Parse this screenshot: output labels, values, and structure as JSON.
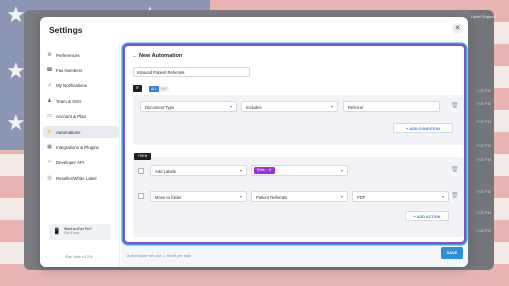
{
  "modal": {
    "title": "Settings",
    "close_icon": "close-icon"
  },
  "sidebar": {
    "items": [
      {
        "label": "Preferences",
        "icon": "gear-icon",
        "glyph": "⚙"
      },
      {
        "label": "Fax Numbers",
        "icon": "fax-icon",
        "glyph": "☎"
      },
      {
        "label": "My Notifications",
        "icon": "bell-icon",
        "glyph": "♫"
      },
      {
        "label": "Team & SSO",
        "icon": "team-icon",
        "glyph": "♟"
      },
      {
        "label": "Account & Plan",
        "icon": "card-icon",
        "glyph": "▭"
      },
      {
        "label": "Automations",
        "icon": "automation-icon",
        "glyph": "⚡"
      },
      {
        "label": "Integrations & Plugins",
        "icon": "plug-icon",
        "glyph": "▦"
      },
      {
        "label": "Developer API",
        "icon": "code-icon",
        "glyph": "‹›"
      },
      {
        "label": "Reseller/White Label",
        "icon": "globe-icon",
        "glyph": "◎"
      }
    ],
    "active_index": 5,
    "promo_title": "Want an iFax Pro?",
    "promo_sub": "Get it now",
    "version": "iFax Web v3.2.8"
  },
  "automation": {
    "back_title": "← New Automation",
    "name_value": "Inbound Patient Referrals",
    "if_label": "IF",
    "toggle_all": "ALL",
    "toggle_any": "ANY",
    "condition": {
      "field": "Document Type",
      "operator": "Includes",
      "value": "Referral"
    },
    "add_condition": "+ ADD CONDITION",
    "then_label": "THEN",
    "action1": {
      "type": "Add Labels",
      "chip": "Refe..."
    },
    "action2": {
      "type": "Move to folder",
      "folder": "Patient Referrals",
      "format": "PDF"
    },
    "add_action": "+ ADD ACTION"
  },
  "footer": {
    "note": "Automation will use 1 credit per task",
    "save_label": "SAVE"
  },
  "background_text": {
    "right_header": "Label Support",
    "times": [
      "7:00 PM",
      "7:00 PM",
      "7:00 PM",
      "7:03 PM",
      "7:03 PM",
      "7:03 PM",
      "7:03 PM",
      "7:03 PM"
    ]
  },
  "colors": {
    "accent_purple": "#7c55c9",
    "accent_blue": "#2f8fd8",
    "chip_purple": "#a12fd1"
  }
}
